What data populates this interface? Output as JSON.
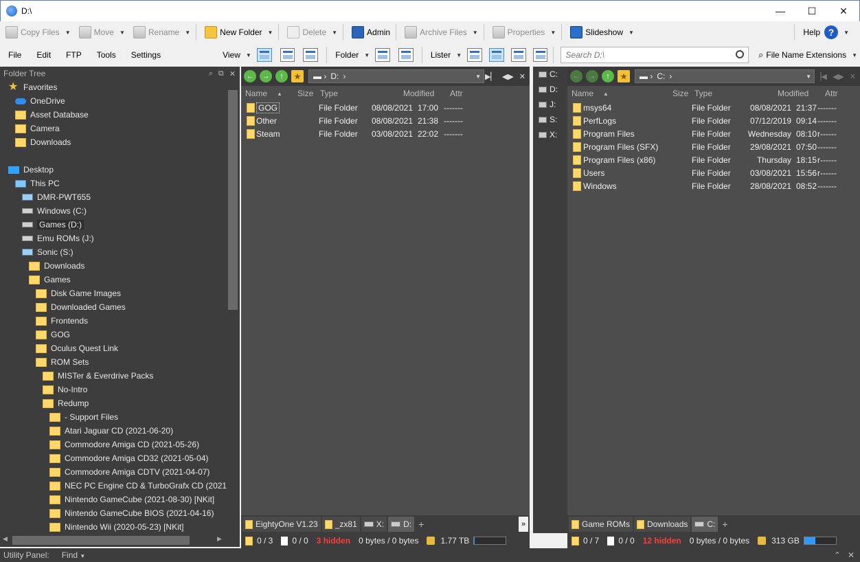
{
  "window": {
    "title": "D:\\",
    "minimize": "—",
    "maximize": "☐",
    "close": "✕"
  },
  "toolbar1": {
    "copy_files": "Copy Files",
    "move": "Move",
    "rename": "Rename",
    "new_folder": "New Folder",
    "delete": "Delete",
    "admin": "Admin",
    "archive_files": "Archive Files",
    "properties": "Properties",
    "slideshow": "Slideshow",
    "help": "Help",
    "help_icon": "?"
  },
  "toolbar2": {
    "menus": [
      "File",
      "Edit",
      "FTP",
      "Tools",
      "Settings"
    ],
    "view": "View",
    "folder": "Folder",
    "lister": "Lister",
    "search_placeholder": "Search D:\\",
    "file_name_extensions": "File Name Extensions"
  },
  "folder_tree": {
    "header": "Folder Tree",
    "items": [
      {
        "label": "Favorites",
        "icon": "star-icon",
        "indent": 1
      },
      {
        "label": "OneDrive",
        "icon": "cloud-icon",
        "indent": 2
      },
      {
        "label": "Asset Database",
        "icon": "folder-icon",
        "indent": 2
      },
      {
        "label": "Camera",
        "icon": "folder-icon",
        "indent": 2
      },
      {
        "label": "Downloads",
        "icon": "folder-icon",
        "indent": 2
      },
      {
        "label": "",
        "icon": "",
        "indent": 0
      },
      {
        "label": "Desktop",
        "icon": "desktop-icon",
        "indent": 1
      },
      {
        "label": "This PC",
        "icon": "pc-icon",
        "indent": 2
      },
      {
        "label": "DMR-PWT655",
        "icon": "device-icon",
        "indent": 3
      },
      {
        "label": "Windows (C:)",
        "icon": "drive-icon",
        "indent": 3
      },
      {
        "label": "Games (D:)",
        "icon": "drive-icon",
        "indent": 3,
        "selected": true
      },
      {
        "label": "Emu ROMs (J:)",
        "icon": "drive-icon",
        "indent": 3
      },
      {
        "label": "Sonic (S:)",
        "icon": "network-drive-icon",
        "indent": 3
      },
      {
        "label": "Downloads",
        "icon": "folder-icon",
        "indent": 4
      },
      {
        "label": "Games",
        "icon": "folder-icon",
        "indent": 4
      },
      {
        "label": "Disk Game Images",
        "icon": "folder-icon",
        "indent": 5
      },
      {
        "label": "Downloaded Games",
        "icon": "folder-icon",
        "indent": 5
      },
      {
        "label": "Frontends",
        "icon": "folder-icon",
        "indent": 5
      },
      {
        "label": "GOG",
        "icon": "folder-icon",
        "indent": 5
      },
      {
        "label": "Oculus Quest Link",
        "icon": "folder-icon",
        "indent": 5
      },
      {
        "label": "ROM Sets",
        "icon": "folder-icon",
        "indent": 5
      },
      {
        "label": "MISTer & Everdrive Packs",
        "icon": "folder-icon",
        "indent": 6
      },
      {
        "label": "No-Intro",
        "icon": "folder-icon",
        "indent": 6
      },
      {
        "label": "Redump",
        "icon": "folder-icon",
        "indent": 6
      },
      {
        "label": "- Support Files",
        "icon": "folder-icon",
        "indent": 7
      },
      {
        "label": "Atari Jaguar CD (2021-06-20)",
        "icon": "folder-icon",
        "indent": 7
      },
      {
        "label": "Commodore Amiga CD (2021-05-26)",
        "icon": "folder-icon",
        "indent": 7
      },
      {
        "label": "Commodore Amiga CD32 (2021-05-04)",
        "icon": "folder-icon",
        "indent": 7
      },
      {
        "label": "Commodore Amiga CDTV (2021-04-07)",
        "icon": "folder-icon",
        "indent": 7
      },
      {
        "label": "NEC PC Engine CD & TurboGrafx CD (2021-",
        "icon": "folder-icon",
        "indent": 7
      },
      {
        "label": "Nintendo GameCube (2021-08-30) [NKit]",
        "icon": "folder-icon",
        "indent": 7
      },
      {
        "label": "Nintendo GameCube BIOS (2021-04-16)",
        "icon": "folder-icon",
        "indent": 7
      },
      {
        "label": "Nintendo Wii (2020-05-23) [NKit]",
        "icon": "folder-icon",
        "indent": 7
      }
    ]
  },
  "left_lister": {
    "path": "D:",
    "columns": {
      "name": "Name",
      "size": "Size",
      "type": "Type",
      "modified": "Modified",
      "attr": "Attr"
    },
    "rows": [
      {
        "name": "GOG",
        "type": "File Folder",
        "date": "08/08/2021",
        "time": "17:00",
        "attr": "-------"
      },
      {
        "name": "Other",
        "type": "File Folder",
        "date": "08/08/2021",
        "time": "21:38",
        "attr": "-------"
      },
      {
        "name": "Steam",
        "type": "File Folder",
        "date": "03/08/2021",
        "time": "22:02",
        "attr": "-------"
      }
    ],
    "tabs": [
      "EightyOne V1.23",
      "_zx81",
      "X:",
      "D:"
    ],
    "tab_more": "»",
    "status": {
      "folders": "0 / 3",
      "files": "0 / 0",
      "hidden": "3 hidden",
      "bytes": "0 bytes / 0 bytes",
      "free": "1.77 TB",
      "free_fraction": 0.02
    }
  },
  "drive_bar": [
    "C:",
    "D:",
    "J:",
    "S:",
    "X:"
  ],
  "right_lister": {
    "path": "C:",
    "columns": {
      "name": "Name",
      "size": "Size",
      "type": "Type",
      "modified": "Modified",
      "attr": "Attr"
    },
    "rows": [
      {
        "name": "msys64",
        "type": "File Folder",
        "date": "08/08/2021",
        "time": "21:37",
        "attr": "-------"
      },
      {
        "name": "PerfLogs",
        "type": "File Folder",
        "date": "07/12/2019",
        "time": "09:14",
        "attr": "-------"
      },
      {
        "name": "Program Files",
        "type": "File Folder",
        "date": "Wednesday",
        "time": "08:10",
        "attr": "r------"
      },
      {
        "name": "Program Files (SFX)",
        "type": "File Folder",
        "date": "29/08/2021",
        "time": "07:50",
        "attr": "-------"
      },
      {
        "name": "Program Files (x86)",
        "type": "File Folder",
        "date": "Thursday",
        "time": "18:15",
        "attr": "r------"
      },
      {
        "name": "Users",
        "type": "File Folder",
        "date": "03/08/2021",
        "time": "15:56",
        "attr": "r------"
      },
      {
        "name": "Windows",
        "type": "File Folder",
        "date": "28/08/2021",
        "time": "08:52",
        "attr": "-------"
      }
    ],
    "tabs": [
      "Game ROMs",
      "Downloads",
      "C:"
    ],
    "status": {
      "folders": "0 / 7",
      "files": "0 / 0",
      "hidden": "12 hidden",
      "bytes": "0 bytes / 0 bytes",
      "free": "313 GB",
      "free_fraction": 0.35
    }
  },
  "utility": {
    "label": "Utility Panel:",
    "find": "Find"
  }
}
